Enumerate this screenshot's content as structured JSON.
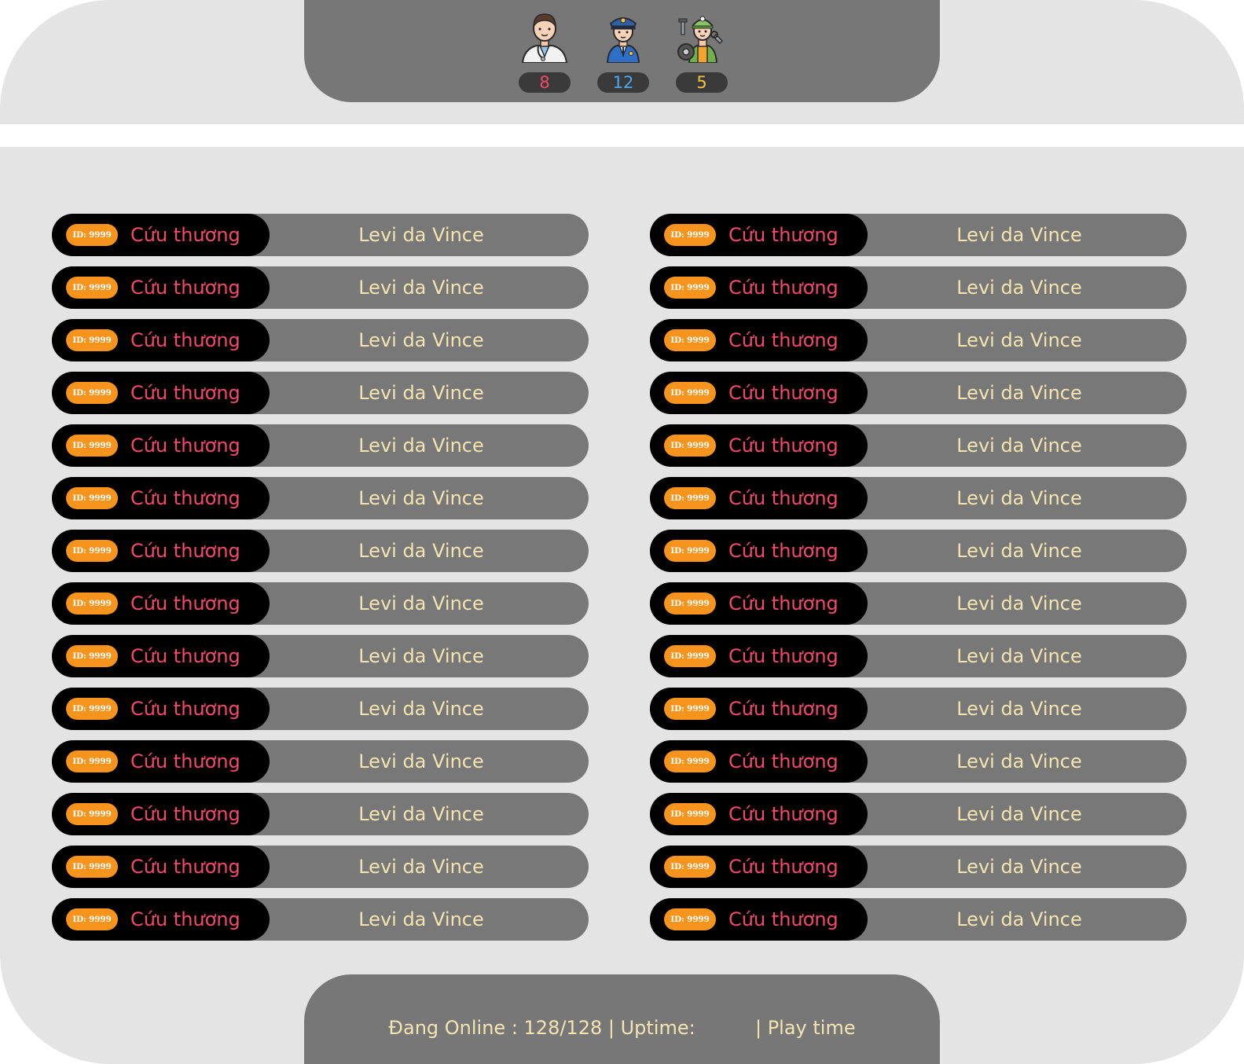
{
  "header": {
    "roles": [
      {
        "name": "doctor",
        "icon": "doctor-icon",
        "count": "8",
        "color": "#f5486a"
      },
      {
        "name": "police",
        "icon": "police-officer-icon",
        "count": "12",
        "color": "#4aa8f0"
      },
      {
        "name": "mechanic",
        "icon": "mechanic-icon",
        "count": "5",
        "color": "#f4c542"
      }
    ]
  },
  "colors": {
    "frame": "#e4e4e4",
    "panel": "#777777",
    "row_bg": "#787878",
    "row_left_bg": "#000000",
    "id_badge": "#f7941d",
    "job_text": "#f5486a",
    "name_text": "#f3e5b0"
  },
  "players": {
    "left": [
      {
        "id": "ID: 9999",
        "job": "Cứu thương",
        "name": "Levi da Vince"
      },
      {
        "id": "ID: 9999",
        "job": "Cứu thương",
        "name": "Levi da Vince"
      },
      {
        "id": "ID: 9999",
        "job": "Cứu thương",
        "name": "Levi da Vince"
      },
      {
        "id": "ID: 9999",
        "job": "Cứu thương",
        "name": "Levi da Vince"
      },
      {
        "id": "ID: 9999",
        "job": "Cứu thương",
        "name": "Levi da Vince"
      },
      {
        "id": "ID: 9999",
        "job": "Cứu thương",
        "name": "Levi da Vince"
      },
      {
        "id": "ID: 9999",
        "job": "Cứu thương",
        "name": "Levi da Vince"
      },
      {
        "id": "ID: 9999",
        "job": "Cứu thương",
        "name": "Levi da Vince"
      },
      {
        "id": "ID: 9999",
        "job": "Cứu thương",
        "name": "Levi da Vince"
      },
      {
        "id": "ID: 9999",
        "job": "Cứu thương",
        "name": "Levi da Vince"
      },
      {
        "id": "ID: 9999",
        "job": "Cứu thương",
        "name": "Levi da Vince"
      },
      {
        "id": "ID: 9999",
        "job": "Cứu thương",
        "name": "Levi da Vince"
      },
      {
        "id": "ID: 9999",
        "job": "Cứu thương",
        "name": "Levi da Vince"
      },
      {
        "id": "ID: 9999",
        "job": "Cứu thương",
        "name": "Levi da Vince"
      }
    ],
    "right": [
      {
        "id": "ID: 9999",
        "job": "Cứu thương",
        "name": "Levi da Vince"
      },
      {
        "id": "ID: 9999",
        "job": "Cứu thương",
        "name": "Levi da Vince"
      },
      {
        "id": "ID: 9999",
        "job": "Cứu thương",
        "name": "Levi da Vince"
      },
      {
        "id": "ID: 9999",
        "job": "Cứu thương",
        "name": "Levi da Vince"
      },
      {
        "id": "ID: 9999",
        "job": "Cứu thương",
        "name": "Levi da Vince"
      },
      {
        "id": "ID: 9999",
        "job": "Cứu thương",
        "name": "Levi da Vince"
      },
      {
        "id": "ID: 9999",
        "job": "Cứu thương",
        "name": "Levi da Vince"
      },
      {
        "id": "ID: 9999",
        "job": "Cứu thương",
        "name": "Levi da Vince"
      },
      {
        "id": "ID: 9999",
        "job": "Cứu thương",
        "name": "Levi da Vince"
      },
      {
        "id": "ID: 9999",
        "job": "Cứu thương",
        "name": "Levi da Vince"
      },
      {
        "id": "ID: 9999",
        "job": "Cứu thương",
        "name": "Levi da Vince"
      },
      {
        "id": "ID: 9999",
        "job": "Cứu thương",
        "name": "Levi da Vince"
      },
      {
        "id": "ID: 9999",
        "job": "Cứu thương",
        "name": "Levi da Vince"
      },
      {
        "id": "ID: 9999",
        "job": "Cứu thương",
        "name": "Levi da Vince"
      }
    ]
  },
  "footer": {
    "status_text": "Đang Online : 128/128 | Uptime:          | Play time"
  }
}
